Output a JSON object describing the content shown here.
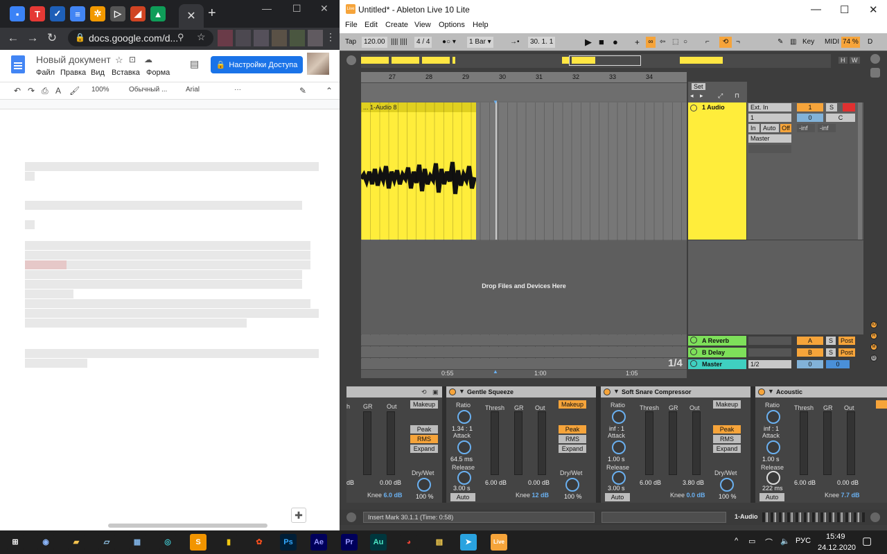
{
  "chrome": {
    "tab_favicons": [
      {
        "name": "chat-icon",
        "color": "#3b82f6",
        "glyph": "▪"
      },
      {
        "name": "t-app-icon",
        "color": "#e53935",
        "glyph": "T"
      },
      {
        "name": "trello-icon",
        "color": "#1e5fb8",
        "glyph": "✓"
      },
      {
        "name": "docs-icon",
        "color": "#4285f4",
        "glyph": "≡"
      },
      {
        "name": "extension-icon",
        "color": "#f29900",
        "glyph": "✲"
      },
      {
        "name": "send-icon",
        "color": "#555555",
        "glyph": "▷"
      },
      {
        "name": "office-icon",
        "color": "#d04423",
        "glyph": "◢"
      },
      {
        "name": "drive-icon",
        "color": "#0f9d58",
        "glyph": "▲"
      }
    ],
    "active_tab_close": "✕",
    "new_tab": "+",
    "window": {
      "minimize": "—",
      "maximize": "☐",
      "close": "✕"
    },
    "nav": {
      "back": "←",
      "forward": "→",
      "reload": "↻"
    },
    "url": "docs.google.com/d...",
    "docs": {
      "title": "Новый документ",
      "menu": [
        "Файл",
        "Правка",
        "Вид",
        "Вставка",
        "Форма"
      ],
      "share_button": "Настройки Доступа",
      "toolbar": {
        "zoom": "100%",
        "style": "Обычный ...",
        "font": "Arial",
        "more": "···"
      }
    }
  },
  "live": {
    "window_title": "Untitled* - Ableton Live 10 Lite",
    "logo_text": "Live",
    "menu": [
      "File",
      "Edit",
      "Create",
      "View",
      "Options",
      "Help"
    ],
    "transport": {
      "tap": "Tap",
      "tempo": "120.00",
      "meter_icon": "|||| ||||",
      "signature": "4 / 4",
      "metronome": "●○ ▾",
      "quantize": "1 Bar ▾",
      "follow": "→•",
      "position": "30.  1.  1",
      "key": "Key",
      "midi": "MIDI",
      "cpu": "74 %",
      "disk": "D"
    },
    "overview": {
      "h_button": "H",
      "w_button": "W"
    },
    "beat_ruler": [
      "27",
      "28",
      "29",
      "30",
      "31",
      "32",
      "33",
      "34"
    ],
    "set_label": "Set",
    "clip_name": "... 1-Audio 8",
    "drop_text": "Drop Files and Devices Here",
    "time_ruler": [
      "0:55",
      "1:00",
      "1:05"
    ],
    "grid_fraction": "1/4",
    "tracks": {
      "audio": {
        "name": "1 Audio",
        "input_type": "Ext. In",
        "input_channel": "1",
        "monitor": [
          "In",
          "Auto",
          "Off"
        ],
        "output": "Master",
        "track_num": "1",
        "solo": "S",
        "volume": "0",
        "pan": "C",
        "meter_l": "-inf",
        "meter_r": "-inf"
      },
      "returns": [
        {
          "name": "A Reverb",
          "letter": "A",
          "solo": "S",
          "mode": "Post"
        },
        {
          "name": "B Delay",
          "letter": "B",
          "solo": "S",
          "mode": "Post"
        }
      ],
      "master": {
        "name": "Master",
        "cue": "1/2",
        "volume": "0",
        "pan": "0"
      }
    },
    "devices": [
      {
        "name": "",
        "labels": {
          "gr": "GR",
          "out": "Out",
          "thresh": "h"
        },
        "threshold_val": "dB",
        "out_val": "0.00 dB",
        "makeup": "Makeup",
        "modes": [
          "Peak",
          "RMS",
          "Expand"
        ],
        "drywet_label": "Dry/Wet",
        "drywet": "100 %",
        "knee_label": "Knee",
        "knee": "6.0 dB"
      },
      {
        "name": "Gentle Squeeze",
        "ratio_label": "Ratio",
        "ratio": "1.34 : 1",
        "attack_label": "Attack",
        "attack": "64.5 ms",
        "release_label": "Release",
        "release": "3.00 s",
        "auto": "Auto",
        "labels": {
          "thresh": "Thresh",
          "gr": "GR",
          "out": "Out"
        },
        "threshold_val": "6.00 dB",
        "out_val": "0.00 dB",
        "makeup": "Makeup",
        "modes": [
          "Peak",
          "RMS",
          "Expand"
        ],
        "drywet_label": "Dry/Wet",
        "drywet": "100 %",
        "knee_label": "Knee",
        "knee": "12 dB"
      },
      {
        "name": "Soft Snare Compressor",
        "ratio_label": "Ratio",
        "ratio": "inf : 1",
        "attack_label": "Attack",
        "attack": "1.00 s",
        "release_label": "Release",
        "release": "3.00 s",
        "auto": "Auto",
        "labels": {
          "thresh": "Thresh",
          "gr": "GR",
          "out": "Out"
        },
        "threshold_val": "6.00 dB",
        "out_val": "3.80 dB",
        "makeup": "Makeup",
        "modes": [
          "Peak",
          "RMS",
          "Expand"
        ],
        "drywet_label": "Dry/Wet",
        "drywet": "100 %",
        "knee_label": "Knee",
        "knee": "0.0 dB"
      },
      {
        "name": "Acoustic",
        "ratio_label": "Ratio",
        "ratio": "inf : 1",
        "attack_label": "Attack",
        "attack": "1.00 s",
        "release_label": "Release",
        "release": "222 ms",
        "auto": "Auto",
        "labels": {
          "thresh": "Thresh",
          "gr": "GR",
          "out": "Out"
        },
        "threshold_val": "6.00 dB",
        "out_val": "0.00 dB",
        "knee_label": "Knee",
        "knee": "7.7 dB"
      }
    ],
    "status": {
      "message": "Insert Mark 30.1.1 (Time: 0:58)",
      "track": "1-Audio"
    },
    "side_icons": [
      "IO",
      "R",
      "M",
      "D"
    ]
  },
  "taskbar": {
    "icons": [
      {
        "name": "start-icon",
        "glyph": "⊞",
        "bg": "#1f1f1f",
        "fg": "#ffffff"
      },
      {
        "name": "app-icon",
        "glyph": "◉",
        "bg": "#1f1f1f",
        "fg": "#8ab4f8"
      },
      {
        "name": "explorer-icon",
        "glyph": "▰",
        "bg": "#1f1f1f",
        "fg": "#f2c14e"
      },
      {
        "name": "notes-icon",
        "glyph": "▱",
        "bg": "#1f1f1f",
        "fg": "#9ad0f5"
      },
      {
        "name": "calculator-icon",
        "glyph": "▦",
        "bg": "#1f1f1f",
        "fg": "#7fb2e5"
      },
      {
        "name": "edge-icon",
        "glyph": "◎",
        "bg": "#1f1f1f",
        "fg": "#3fc1c9"
      },
      {
        "name": "sublime-icon",
        "glyph": "S",
        "bg": "#f29500",
        "fg": "#ffffff"
      },
      {
        "name": "powerbi-icon",
        "glyph": "▮",
        "bg": "#1f1f1f",
        "fg": "#f2c811"
      },
      {
        "name": "figma-icon",
        "glyph": "✿",
        "bg": "#1f1f1f",
        "fg": "#f24e1e"
      },
      {
        "name": "photoshop-icon",
        "glyph": "Ps",
        "bg": "#001e36",
        "fg": "#31a8ff"
      },
      {
        "name": "aftereffects-icon",
        "glyph": "Ae",
        "bg": "#00005b",
        "fg": "#9999ff"
      },
      {
        "name": "premiere-icon",
        "glyph": "Pr",
        "bg": "#00005b",
        "fg": "#9999ff"
      },
      {
        "name": "audition-icon",
        "glyph": "Au",
        "bg": "#00363d",
        "fg": "#4de7c4"
      },
      {
        "name": "chrome-icon",
        "glyph": "◕",
        "bg": "#1f1f1f",
        "fg": "#ea4335"
      },
      {
        "name": "files-icon",
        "glyph": "▤",
        "bg": "#1f1f1f",
        "fg": "#ffd54f"
      },
      {
        "name": "telegram-icon",
        "glyph": "➤",
        "bg": "#2aa3e0",
        "fg": "#ffffff"
      },
      {
        "name": "live-icon",
        "glyph": "Live",
        "bg": "#f6a43a",
        "fg": "#ffffff"
      }
    ],
    "tray": {
      "chevron": "^",
      "lang": "РУС",
      "time": "15:49",
      "date": "24.12.2020"
    }
  }
}
